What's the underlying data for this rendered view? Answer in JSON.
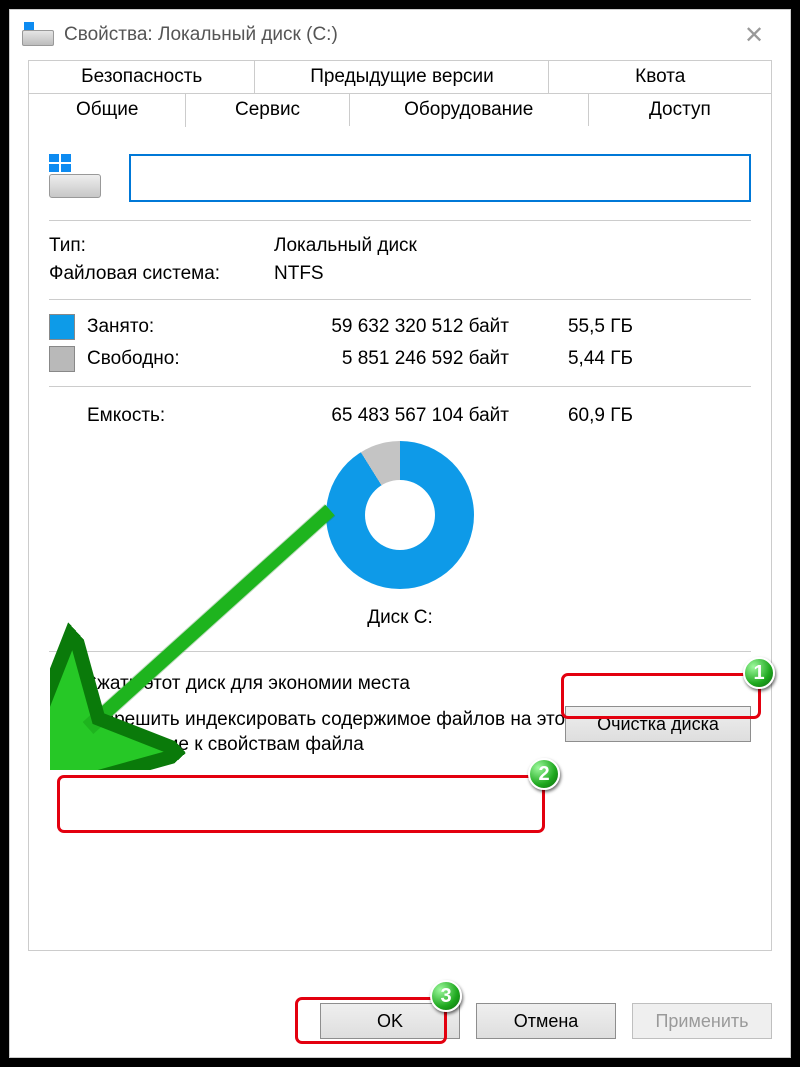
{
  "title": "Свойства: Локальный диск (C:)",
  "tabs_row1": [
    "Безопасность",
    "Предыдущие версии",
    "Квота"
  ],
  "tabs_row2": [
    "Общие",
    "Сервис",
    "Оборудование",
    "Доступ"
  ],
  "drive_name_value": "",
  "type_label": "Тип:",
  "type_value": "Локальный диск",
  "fs_label": "Файловая система:",
  "fs_value": "NTFS",
  "used_label": "Занято:",
  "used_bytes": "59 632 320 512 байт",
  "used_gb": "55,5 ГБ",
  "free_label": "Свободно:",
  "free_bytes": "5 851 246 592 байт",
  "free_gb": "5,44 ГБ",
  "cap_label": "Емкость:",
  "cap_bytes": "65 483 567 104 байт",
  "cap_gb": "60,9 ГБ",
  "donut_label": "Диск C:",
  "cleanup_btn": "Очистка диска",
  "cb_compress": "Сжать этот диск для экономии места",
  "cb_index": "Разрешить индексировать содержимое файлов на этом диске в дополнение к свойствам файла",
  "btn_ok": "OK",
  "btn_cancel": "Отмена",
  "btn_apply": "Применить",
  "badges": {
    "b1": "1",
    "b2": "2",
    "b3": "3"
  }
}
